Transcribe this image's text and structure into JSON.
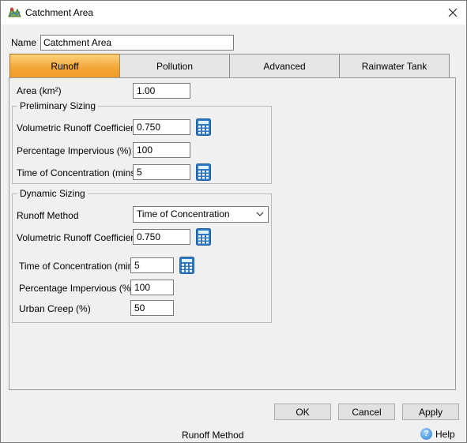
{
  "window": {
    "title": "Catchment Area",
    "close_icon": "close-icon",
    "app_icon": "catchment-map-icon"
  },
  "name": {
    "label": "Name",
    "value": "Catchment Area"
  },
  "tabs": [
    {
      "label": "Runoff",
      "active": true
    },
    {
      "label": "Pollution",
      "active": false
    },
    {
      "label": "Advanced",
      "active": false
    },
    {
      "label": "Rainwater Tank",
      "active": false
    }
  ],
  "area": {
    "label": "Area (km²)",
    "value": "1.00"
  },
  "preliminary": {
    "title": "Preliminary Sizing",
    "vrc_label": "Volumetric Runoff Coefficient",
    "vrc_value": "0.750",
    "pct_label": "Percentage Impervious (%)",
    "pct_value": "100",
    "toc_label": "Time of Concentration (mins)",
    "toc_value": "5"
  },
  "dynamic": {
    "title": "Dynamic Sizing",
    "method_label": "Runoff Method",
    "method_value": "Time of Concentration",
    "vrc_label": "Volumetric Runoff Coefficient",
    "vrc_value": "0.750",
    "toc_label": "Time of Concentration (mins)",
    "toc_value": "5",
    "pct_label": "Percentage Impervious (%)",
    "pct_value": "100",
    "creep_label": "Urban Creep (%)",
    "creep_value": "50"
  },
  "buttons": {
    "ok": "OK",
    "cancel": "Cancel",
    "apply": "Apply"
  },
  "status_text": "Runoff Method",
  "help": {
    "label": "Help",
    "icon": "help-icon"
  },
  "colors": {
    "active_tab": "#f3a73a",
    "calc_icon": "#1f5f9c"
  }
}
